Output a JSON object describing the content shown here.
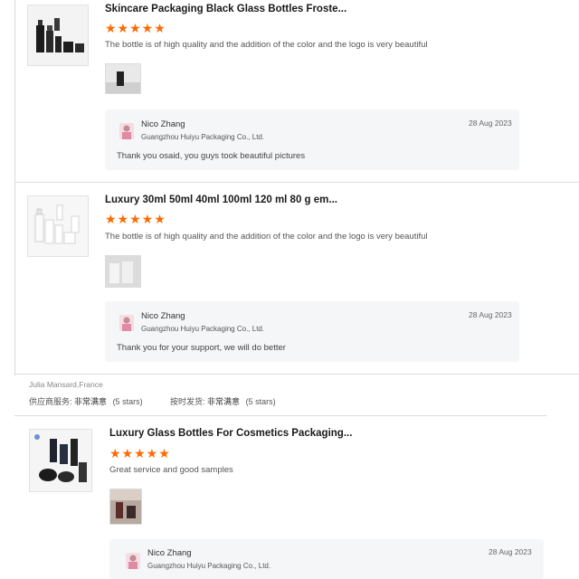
{
  "reviews": [
    {
      "title": "Skincare Packaging Black Glass Bottles Froste...",
      "stars": "★★★★★",
      "comment": "The bottle is of high quality and the addition of the color and the logo is very beautiful",
      "reply": {
        "name": "Nico Zhang",
        "company": "Guangzhou Huiyu Packaging Co., Ltd.",
        "date": "28 Aug 2023",
        "text": "Thank you osaid, you guys took beautiful pictures"
      }
    },
    {
      "title": "Luxury 30ml 50ml 40ml 100ml 120 ml 80 g em...",
      "stars": "★★★★★",
      "comment": "The bottle is of high quality and the addition of the color and the logo is very beautiful",
      "reply": {
        "name": "Nico Zhang",
        "company": "Guangzhou Huiyu Packaging Co., Ltd.",
        "date": "28 Aug 2023",
        "text": "Thank you for your support, we will do better"
      }
    },
    {
      "title": "Luxury Glass Bottles For Cosmetics Packaging...",
      "stars": "★★★★★",
      "comment": "Great service and good samples",
      "reply": {
        "name": "Nico Zhang",
        "company": "Guangzhou Huiyu Packaging Co., Ltd.",
        "date": "28 Aug 2023"
      }
    }
  ],
  "reviewer": {
    "name": "Julia Mansard,France",
    "supplier_service_label": "供应商服务:",
    "supplier_service_value": "非常满意",
    "supplier_service_stars": "(5 stars)",
    "ontime_label": "按时发货:",
    "ontime_value": "非常满意",
    "ontime_stars": "(5 stars)"
  },
  "colors": {
    "star": "#ff6a00",
    "reply_bg": "#f5f6f8"
  }
}
